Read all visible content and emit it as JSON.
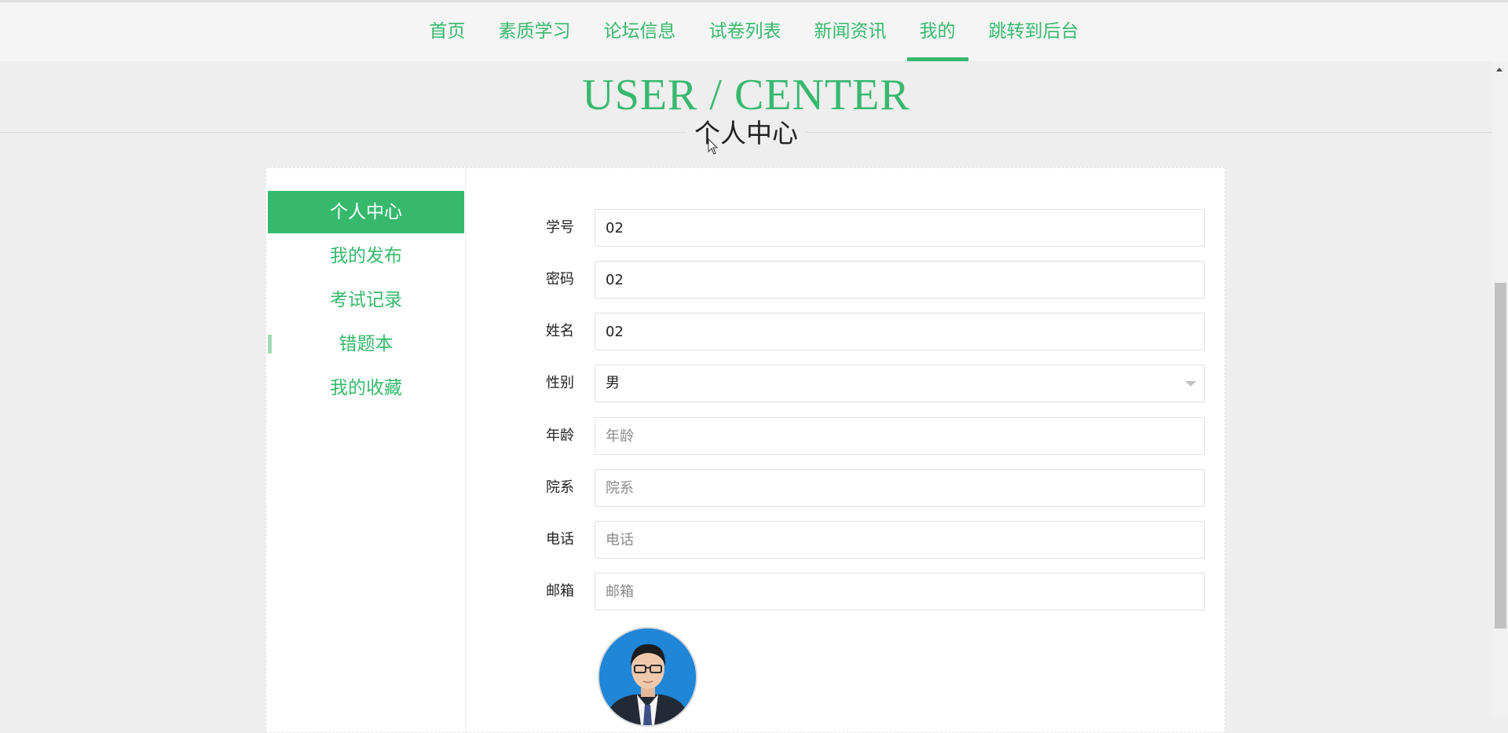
{
  "nav": {
    "items": [
      {
        "label": "首页"
      },
      {
        "label": "素质学习"
      },
      {
        "label": "论坛信息"
      },
      {
        "label": "试卷列表"
      },
      {
        "label": "新闻资讯"
      },
      {
        "label": "我的"
      },
      {
        "label": "跳转到后台"
      }
    ],
    "active_label": "我的"
  },
  "header": {
    "title_en": "USER / CENTER",
    "title_cn": "个人中心"
  },
  "sidebar": {
    "items": [
      {
        "label": "个人中心"
      },
      {
        "label": "我的发布"
      },
      {
        "label": "考试记录"
      },
      {
        "label": "错题本"
      },
      {
        "label": "我的收藏"
      }
    ],
    "active_label": "个人中心"
  },
  "form": {
    "student_id": {
      "label": "学号",
      "value": "02"
    },
    "password": {
      "label": "密码",
      "value": "02"
    },
    "name": {
      "label": "姓名",
      "value": "02"
    },
    "gender": {
      "label": "性别",
      "value": "男"
    },
    "age": {
      "label": "年龄",
      "placeholder": "年龄"
    },
    "department": {
      "label": "院系",
      "placeholder": "院系"
    },
    "phone": {
      "label": "电话",
      "placeholder": "电话"
    },
    "email": {
      "label": "邮箱",
      "placeholder": "邮箱"
    }
  },
  "colors": {
    "accent": "#37b96d",
    "page_bg": "#eeeeee",
    "avatar_bg": "#1f86d8"
  },
  "icons": {
    "cursor": "mouse-pointer-icon",
    "select": "caret-down-icon",
    "scroll": "scroll-up-icon"
  }
}
